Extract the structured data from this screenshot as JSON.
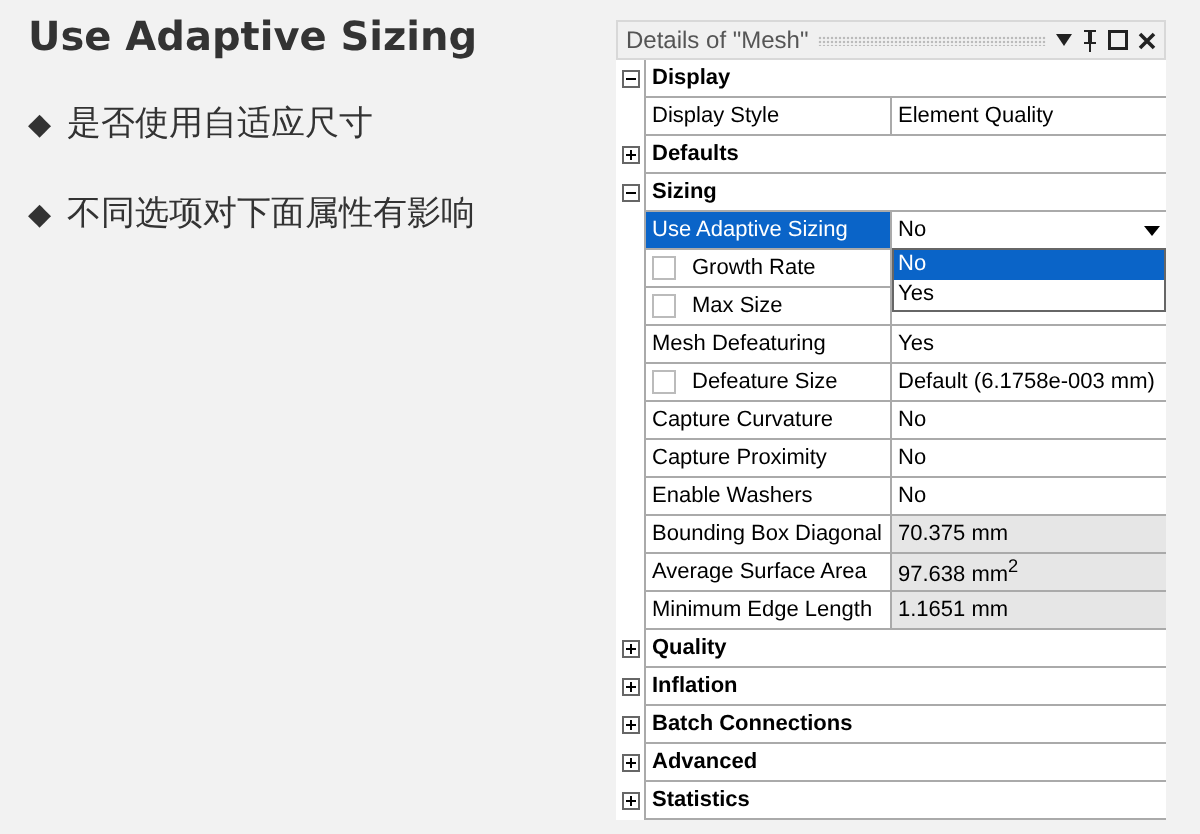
{
  "slide": {
    "title": "Use Adaptive Sizing",
    "bullets": [
      {
        "marker": "◆",
        "text": "是否使用自适应尺寸"
      },
      {
        "marker": "◆",
        "text": "不同选项对下面属性有影响"
      }
    ]
  },
  "panel": {
    "title": "Details of \"Mesh\"",
    "groups": [
      {
        "name": "Display",
        "expanded": true,
        "rows": [
          {
            "label": "Display Style",
            "value": "Element Quality",
            "readonly": false,
            "selected": false
          }
        ]
      },
      {
        "name": "Defaults",
        "expanded": false
      },
      {
        "name": "Sizing",
        "expanded": true,
        "rows": [
          {
            "label": "Use Adaptive Sizing",
            "value": "No",
            "readonly": false,
            "selected": true,
            "dropdown": {
              "options": [
                {
                  "label": "No",
                  "selected": true
                },
                {
                  "label": "Yes",
                  "selected": false
                }
              ]
            }
          },
          {
            "label": "Growth Rate",
            "checked": false,
            "selected": false
          },
          {
            "label": "Max Size",
            "checked": false,
            "selected": false
          },
          {
            "label": "Mesh Defeaturing",
            "value": "Yes",
            "readonly": false,
            "selected": false
          },
          {
            "label": "Defeature Size",
            "checked": false,
            "value": "Default (6.1758e-003 mm)",
            "readonly": false,
            "selected": false
          },
          {
            "label": "Capture Curvature",
            "value": "No",
            "readonly": false,
            "selected": false
          },
          {
            "label": "Capture Proximity",
            "value": "No",
            "readonly": false,
            "selected": false
          },
          {
            "label": "Enable Washers",
            "value": "No",
            "readonly": false,
            "selected": false
          },
          {
            "label": "Bounding Box Diagonal",
            "value": "70.375 mm",
            "readonly": true,
            "selected": false
          },
          {
            "label": "Average Surface Area",
            "value": "97.638 mm$^{2}$",
            "readonly": true,
            "selected": false
          },
          {
            "label": "Minimum Edge Length",
            "value": "1.1651 mm",
            "readonly": true,
            "selected": false
          }
        ]
      },
      {
        "name": "Quality",
        "expanded": false
      },
      {
        "name": "Inflation",
        "expanded": false
      },
      {
        "name": "Batch Connections",
        "expanded": false
      },
      {
        "name": "Advanced",
        "expanded": false
      },
      {
        "name": "Statistics",
        "expanded": false
      }
    ]
  }
}
